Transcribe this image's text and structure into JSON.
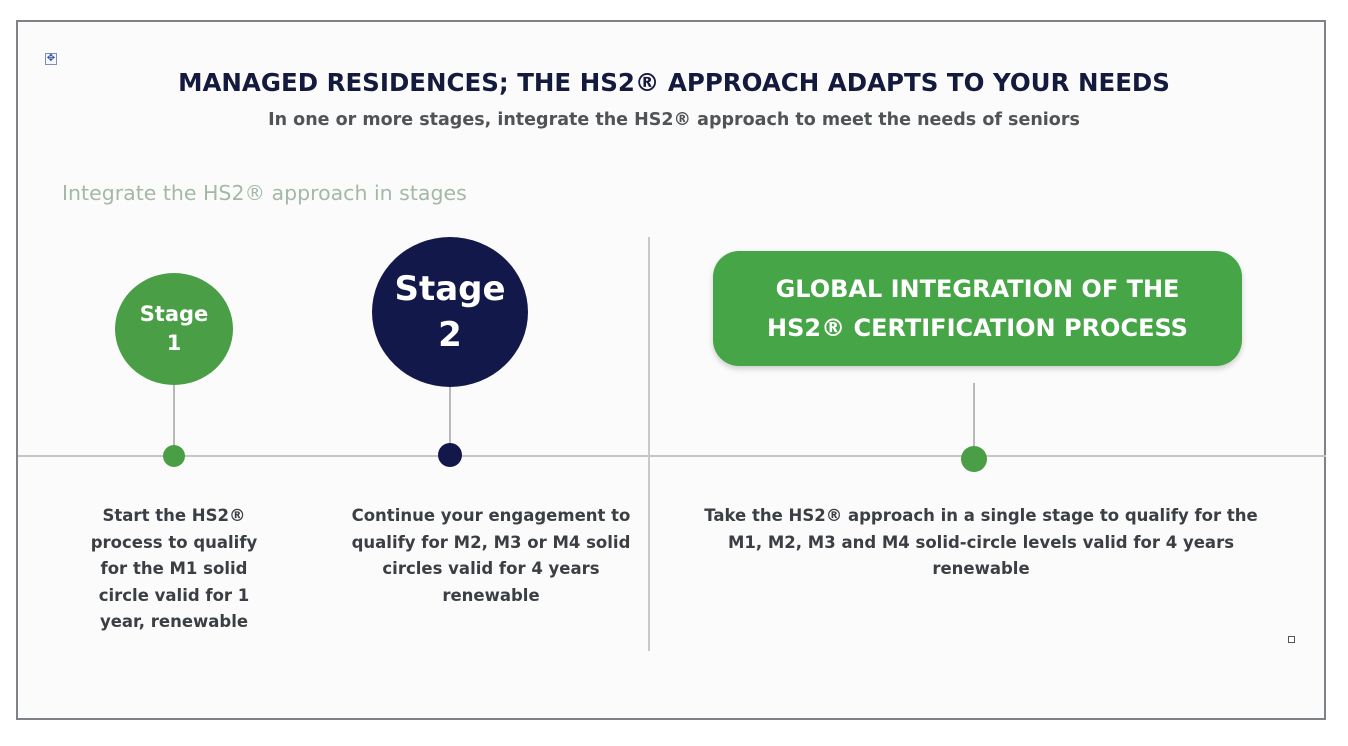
{
  "header": {
    "title": "MANAGED RESIDENCES; THE HS2® APPROACH ADAPTS TO YOUR NEEDS",
    "subtitle": "In one or more stages, integrate the HS2® approach to meet the needs of seniors"
  },
  "section_label": "Integrate the HS2® approach in stages",
  "stages": [
    {
      "label_line1": "Stage",
      "label_line2": "1",
      "description_lines": [
        "Start the HS2®",
        "process to qualify",
        "for the M1 solid",
        "circle valid for 1",
        "year, renewable"
      ]
    },
    {
      "label_line1": "Stage",
      "label_line2": "2",
      "description_lines": [
        "Continue your engagement to",
        "qualify for M2, M3 or M4 solid",
        "circles valid for 4 years",
        "renewable"
      ]
    }
  ],
  "global": {
    "label_line1": "GLOBAL INTEGRATION OF THE",
    "label_line2": "HS2® CERTIFICATION PROCESS",
    "description_lines": [
      "Take the HS2® approach in a single stage to qualify for the",
      "M1, M2, M3 and M4 solid-circle levels valid for 4 years",
      "renewable"
    ]
  },
  "colors": {
    "green": "#4a9e46",
    "navy": "#13184a",
    "title": "#141a3d"
  },
  "icons": {
    "move_handle": "move-icon",
    "resize_handle": "resize-handle-icon"
  }
}
